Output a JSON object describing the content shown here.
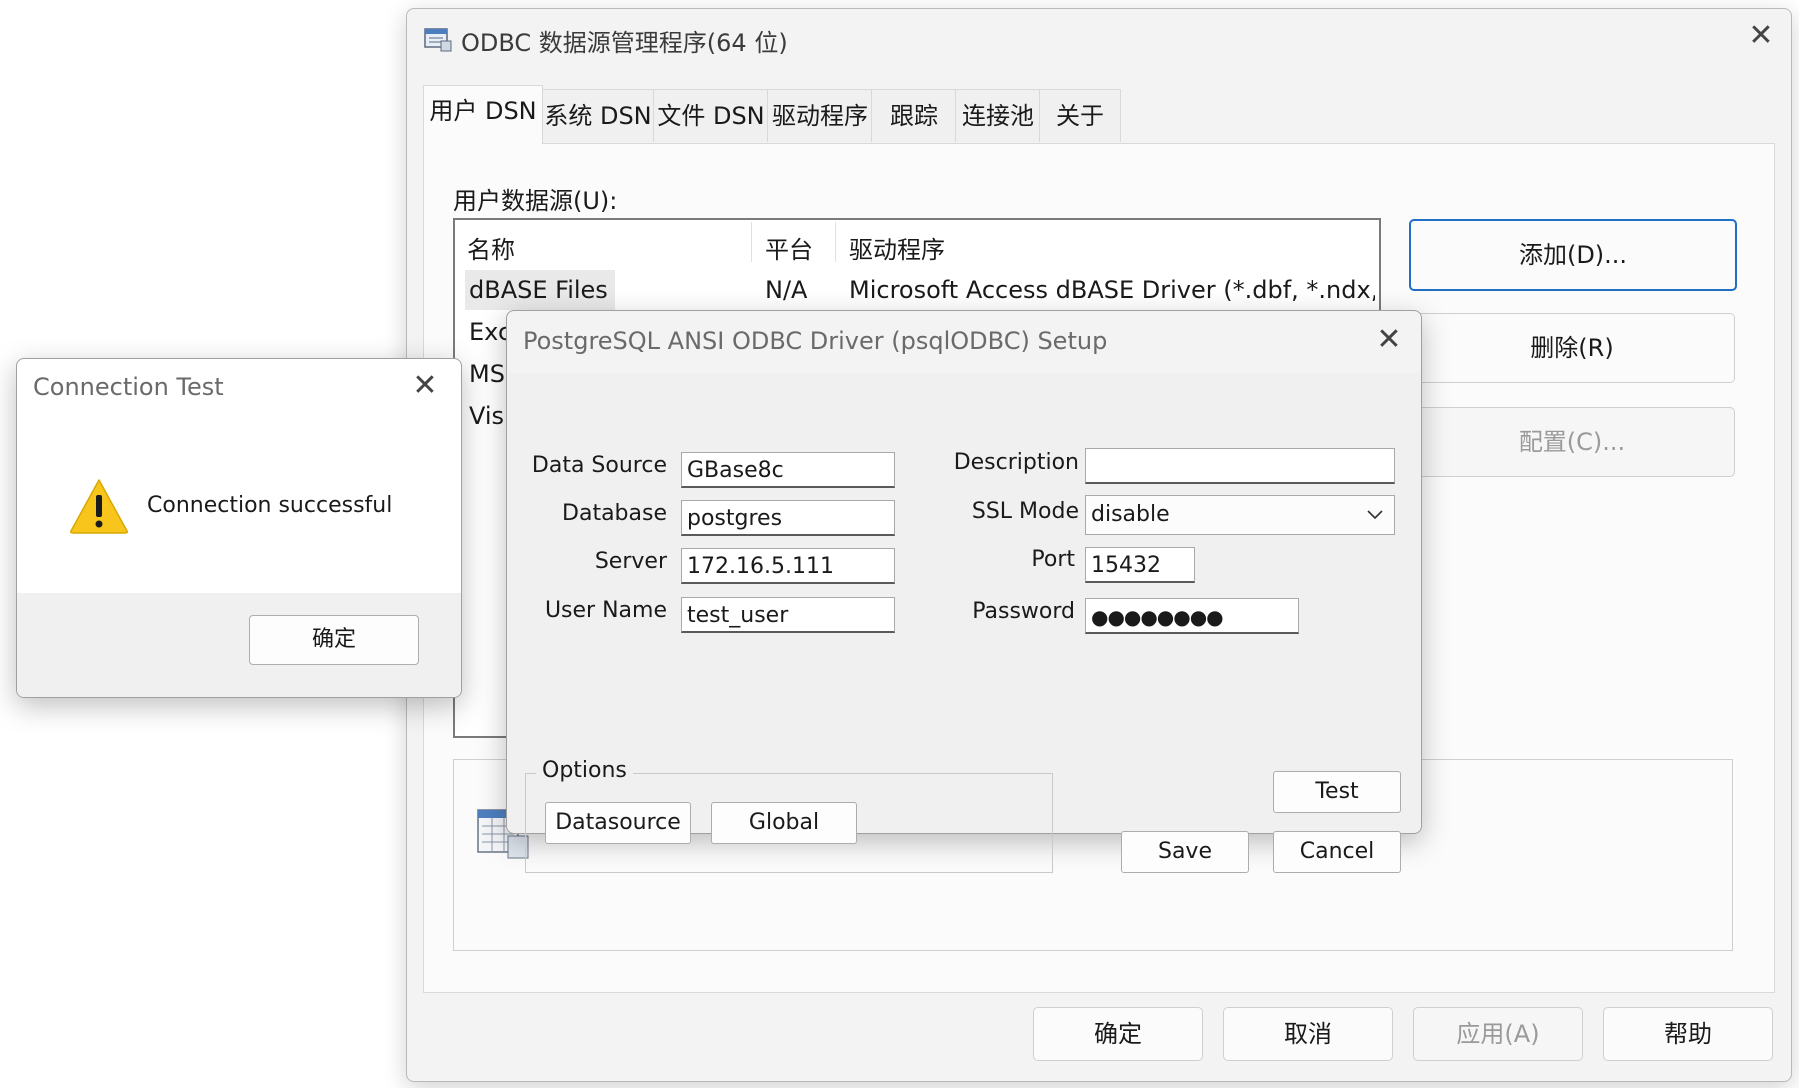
{
  "odbc": {
    "title": "ODBC 数据源管理程序(64 位)",
    "close_glyph": "✕",
    "tabs": [
      "用户 DSN",
      "系统 DSN",
      "文件 DSN",
      "驱动程序",
      "跟踪",
      "连接池",
      "关于"
    ],
    "list_label": "用户数据源(U):",
    "columns": [
      "名称",
      "平台",
      "驱动程序"
    ],
    "rows": [
      {
        "name": "dBASE Files",
        "platform": "N/A",
        "driver": "Microsoft Access dBASE Driver (*.dbf, *.ndx, *"
      },
      {
        "name": "Exc",
        "platform": "",
        "driver": ""
      },
      {
        "name": "MS",
        "platform": "",
        "driver": ""
      },
      {
        "name": "Visi",
        "platform": "",
        "driver": ""
      }
    ],
    "side_buttons": {
      "add": "添加(D)...",
      "remove": "删除(R)",
      "configure": "配置(C)..."
    },
    "bottom_buttons": {
      "ok": "确定",
      "cancel": "取消",
      "apply": "应用(A)",
      "help": "帮助"
    },
    "icon": "odbc-datasource-icon"
  },
  "pg_setup": {
    "title": "PostgreSQL ANSI ODBC Driver (psqlODBC) Setup",
    "close_glyph": "✕",
    "labels": {
      "data_source": "Data Source",
      "database": "Database",
      "server": "Server",
      "user_name": "User Name",
      "description": "Description",
      "ssl_mode": "SSL Mode",
      "port": "Port",
      "password": "Password"
    },
    "values": {
      "data_source": "GBase8c",
      "database": "postgres",
      "server": "172.16.5.111",
      "user_name": "test_user",
      "description": "",
      "ssl_mode": "disable",
      "port": "15432",
      "password": "●●●●●●●●"
    },
    "options_legend": "Options",
    "buttons": {
      "datasource": "Datasource",
      "global": "Global",
      "test": "Test",
      "save": "Save",
      "cancel": "Cancel"
    }
  },
  "conn_test": {
    "title": "Connection Test",
    "close_glyph": "✕",
    "message": "Connection successful",
    "ok": "确定",
    "icon": "warning-icon"
  }
}
